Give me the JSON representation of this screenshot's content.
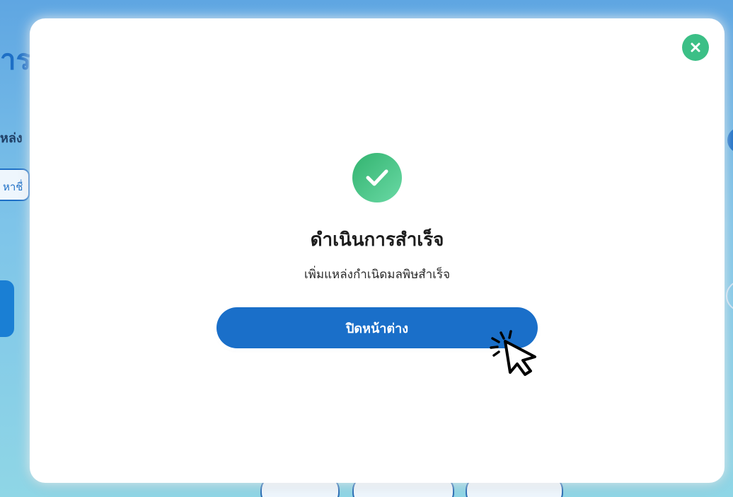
{
  "background": {
    "title_fragment": "ารเ",
    "label_fragment": "หล่ง",
    "search_fragment": "หาชื่"
  },
  "modal": {
    "title": "ดำเนินการสำเร็จ",
    "message": "เพิ่มแหล่งกำเนิดมลพิษสำเร็จ",
    "close_window_label": "ปิดหน้าต่าง",
    "close_icon": "close-icon",
    "status_icon": "check-circle-icon"
  },
  "colors": {
    "primary": "#1a6fc9",
    "success": "#3bbf86",
    "overlay": "#7ec4e9"
  }
}
